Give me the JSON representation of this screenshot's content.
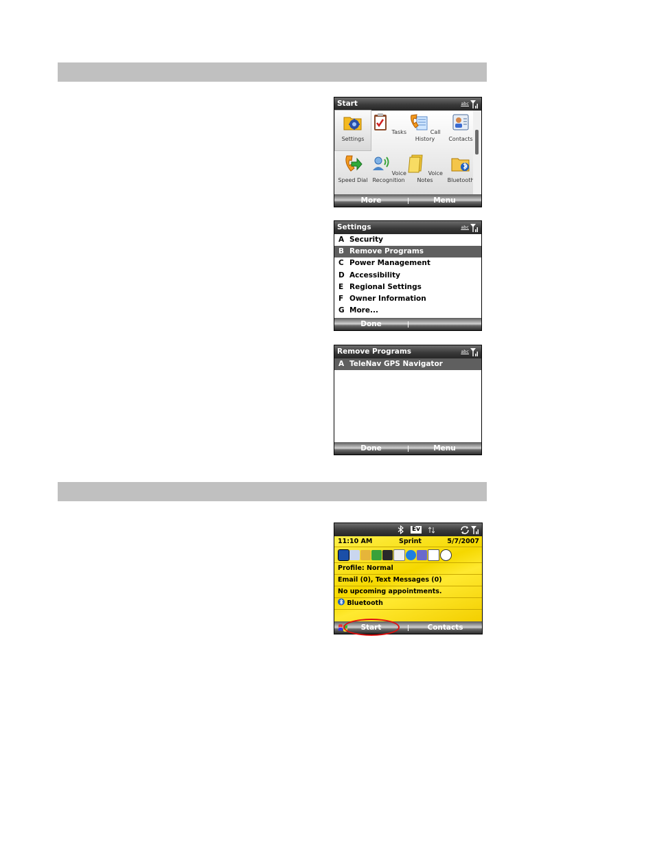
{
  "screen_start": {
    "title": "Start",
    "status_abc": "abc",
    "items": [
      {
        "label": "Settings",
        "icon": "settings-folder-icon"
      },
      {
        "label": "Tasks",
        "icon": "tasks-clipboard-icon"
      },
      {
        "label": "Call History",
        "icon": "call-history-icon"
      },
      {
        "label": "Contacts",
        "icon": "contacts-card-icon"
      },
      {
        "label": "Speed Dial",
        "icon": "speed-dial-icon"
      },
      {
        "label": "Voice Recognition",
        "icon": "voice-recognition-icon"
      },
      {
        "label": "Voice Notes",
        "icon": "voice-notes-icon"
      },
      {
        "label": "Bluetooth",
        "icon": "bluetooth-folder-icon"
      }
    ],
    "soft_left": "More",
    "soft_right": "Menu"
  },
  "screen_settings": {
    "title": "Settings",
    "status_abc": "abc",
    "items": [
      {
        "key": "A",
        "label": "Security"
      },
      {
        "key": "B",
        "label": "Remove Programs"
      },
      {
        "key": "C",
        "label": "Power Management"
      },
      {
        "key": "D",
        "label": "Accessibility"
      },
      {
        "key": "E",
        "label": "Regional Settings"
      },
      {
        "key": "F",
        "label": "Owner Information"
      },
      {
        "key": "G",
        "label": "More..."
      }
    ],
    "selected_index": 1,
    "soft_left": "Done",
    "soft_right": ""
  },
  "screen_remove": {
    "title": "Remove Programs",
    "status_abc": "abc",
    "items": [
      {
        "key": "A",
        "label": "TeleNav GPS Navigator"
      }
    ],
    "soft_left": "Done",
    "soft_right": "Menu"
  },
  "screen_home": {
    "status_icons": [
      "bluetooth-icon",
      "ev-data-icon",
      "signal-icon"
    ],
    "status_ev": "Ev",
    "time": "11:10 AM",
    "carrier": "Sprint",
    "date": "5/7/2007",
    "profile": "Profile: Normal",
    "messages": "Email (0), Text Messages (0)",
    "appointments": "No upcoming appointments.",
    "bluetooth": "Bluetooth",
    "soft_left": "Start",
    "soft_right": "Contacts"
  },
  "colors": {
    "section_bar": "#c0c0c0",
    "title_bar": "#3a3a3a",
    "selection": "#5f5f5f",
    "home_yellow": "#f5d800",
    "highlight_ring": "#e01010"
  }
}
